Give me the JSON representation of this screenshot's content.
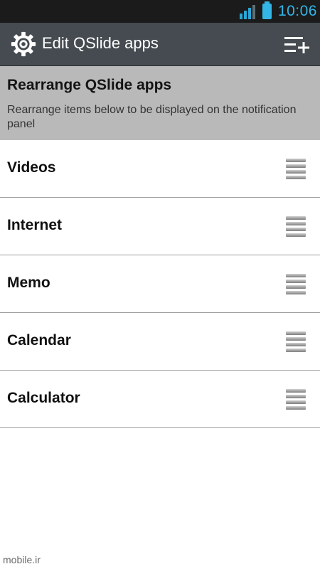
{
  "status_bar": {
    "time": "10:06",
    "signal_icon": "signal-bars-icon",
    "battery_icon": "battery-icon"
  },
  "action_bar": {
    "title": "Edit QSlide apps",
    "left_icon": "gear-icon",
    "right_icon": "add-to-list-icon"
  },
  "header": {
    "title": "Rearrange QSlide apps",
    "description": "Rearrange items below to be displayed on the notification panel"
  },
  "list": {
    "items": [
      {
        "label": "Videos"
      },
      {
        "label": "Internet"
      },
      {
        "label": "Memo"
      },
      {
        "label": "Calendar"
      },
      {
        "label": "Calculator"
      }
    ]
  },
  "watermark": "mobile.ir",
  "colors": {
    "accent": "#33b5e5",
    "action_bar": "#454b50",
    "header_panel": "#b9b9b9"
  }
}
